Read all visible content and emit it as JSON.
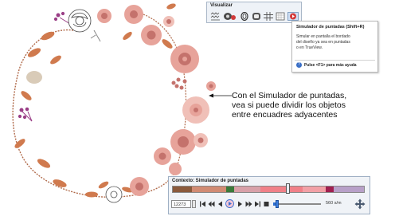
{
  "toolbar": {
    "title": "Visualizar",
    "icons": [
      "stitch-view-icon",
      "trueview-icon",
      "show-objects-icon",
      "grid-icon",
      "stitch-simulator-icon"
    ]
  },
  "tooltip": {
    "title": "Simulador de puntadas (Shift+R)",
    "body": "Simular en pantalla el bordado del diseño ya sea en puntadas o en TrueView.",
    "help": "Pulse <F1> para más ayuda"
  },
  "callout": {
    "text": "Con el Simulador de puntadas, vea si puede dividir los objetos entre encuadres adyacentes"
  },
  "player": {
    "title": "Contexto: Simulador de puntadas",
    "progress_fraction": 0.6,
    "stitch_value": "12273",
    "speed_label": "560 s/m",
    "speed_fraction": 0.05,
    "bar_colors": [
      "#8b5a3c",
      "#d18b73",
      "#3a7a3a",
      "#d8a0a8",
      "#f08088",
      "#f2a0a6",
      "#a02050",
      "#b8a0c8"
    ]
  },
  "colors": {
    "rose": "#e7a39a",
    "rose_dark": "#c4726c",
    "leaf": "#d07a4e",
    "stem": "#b06a4a",
    "purple": "#9a3e86",
    "accent_blue": "#2e6fd0"
  }
}
